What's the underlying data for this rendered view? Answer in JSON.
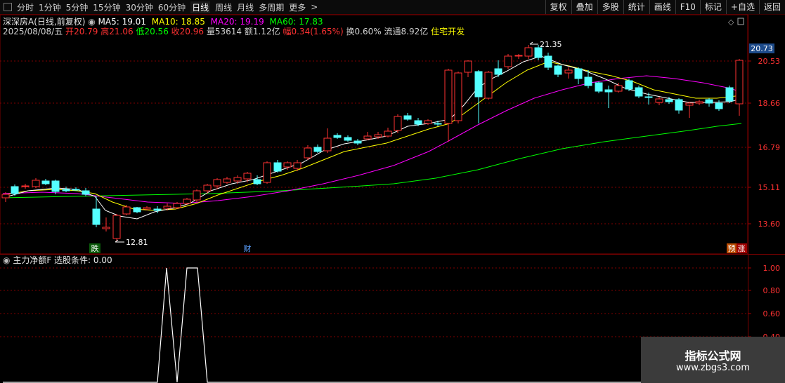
{
  "toolbar": {
    "left_tabs": [
      "分时",
      "1分钟",
      "5分钟",
      "15分钟",
      "30分钟",
      "60分钟",
      "日线",
      "周线",
      "月线",
      "多周期",
      "更多"
    ],
    "active_tab": "日线",
    "right_buttons": [
      "复权",
      "叠加",
      "多股",
      "统计",
      "画线",
      "F10",
      "标记",
      "+自选",
      "返回"
    ]
  },
  "header": {
    "stock_name": "深深房A",
    "mode": "(日线,前复权)",
    "ma5": "MA5: 19.01",
    "ma10": "MA10: 18.85",
    "ma20": "MA20: 19.19",
    "ma60": "MA60: 17.83",
    "date": "2025/08/08/五",
    "open_label": "开",
    "open": "20.79",
    "high_label": "高",
    "high": "21.06",
    "low_label": "低",
    "low": "20.56",
    "close_label": "收",
    "close": "20.96",
    "vol_label": "量",
    "vol": "53614",
    "amt_label": "额",
    "amt": "1.12亿",
    "chg_label": "幅",
    "chg": "0.34(1.65%)",
    "turn_label": "换",
    "turn": "0.60%",
    "float_label": "流通",
    "float": "8.92亿",
    "industry": "住宅开发"
  },
  "price_axis": {
    "labels": [
      "20.53",
      "18.66",
      "16.79",
      "15.11",
      "13.60"
    ],
    "current": "20.73"
  },
  "annotations": {
    "high_marker": "21.35",
    "low_marker": "12.81",
    "tag_drop": "跌",
    "tag_fin": "财",
    "tag_pre": "预",
    "tag_rise": "涨"
  },
  "indicator": {
    "title": "主力净额F",
    "condition": "选股条件: 0.00",
    "axis_labels": [
      "1.00",
      "0.80",
      "0.60",
      "0.40"
    ]
  },
  "watermark": {
    "line1": "指标公式网",
    "line2": "www.zbgs3.com"
  },
  "colors": {
    "up": "#ff3232",
    "down": "#54ffff",
    "ma5": "#ffffff",
    "ma10": "#ffff00",
    "ma20": "#ff00ff",
    "ma60": "#00ff00",
    "grid": "#800000"
  }
}
